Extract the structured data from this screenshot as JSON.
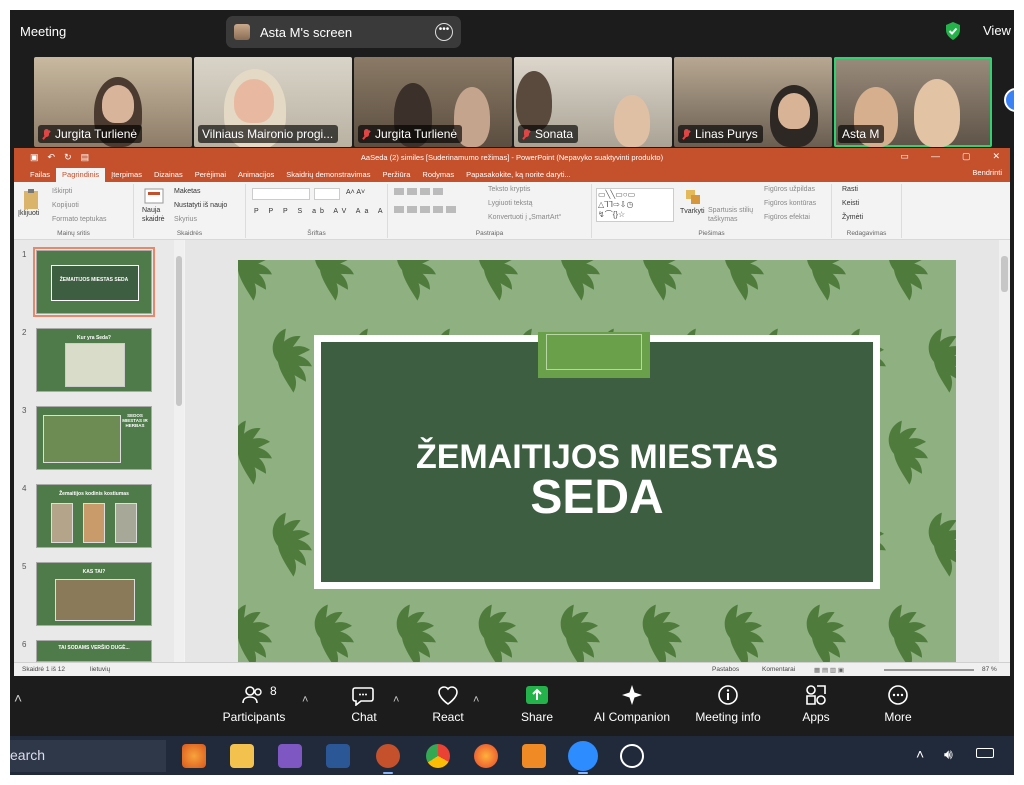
{
  "zoom": {
    "meeting_label": "Meeting",
    "share_label": "Asta M's screen",
    "view_label": "View",
    "participants": [
      {
        "name": "Jurgita Turlienė",
        "muted": true
      },
      {
        "name": "Vilniaus Maironio progi...",
        "muted": false
      },
      {
        "name": "Jurgita Turlienė",
        "muted": true
      },
      {
        "name": "Sonata",
        "muted": true
      },
      {
        "name": "Linas Purys",
        "muted": true
      },
      {
        "name": "Asta M",
        "muted": false
      }
    ],
    "controls": {
      "participants": "Participants",
      "participants_count": "8",
      "chat": "Chat",
      "react": "React",
      "share": "Share",
      "ai": "AI Companion",
      "info": "Meeting info",
      "apps": "Apps",
      "more": "More"
    }
  },
  "ppt": {
    "title": "AaSeda (2) similes [Suderinamumo režimas] - PowerPoint (Nepavyko suaktyvinti produkto)",
    "tabs": [
      "Failas",
      "Pagrindinis",
      "Įterpimas",
      "Dizainas",
      "Perėjimai",
      "Animacijos",
      "Skaidrių demonstravimas",
      "Peržiūra",
      "Rodymas",
      "Papasakokite, ką norite daryti..."
    ],
    "share": "Bendrinti",
    "ribbon": {
      "paste": "Įklijuoti",
      "cut": "Iškirpti",
      "copy": "Kopijuoti",
      "format_painter": "Formato teptukas",
      "clipboard_group": "Mainų sritis",
      "new_slide": "Nauja skaidrė",
      "layout": "Maketas",
      "reset": "Nustatyti iš naujo",
      "section": "Skyrius",
      "slides_group": "Skaidrės",
      "font_group": "Šriftas",
      "text_direction": "Teksto kryptis",
      "align_text": "Lygiuoti tekstą",
      "smartart": "Konvertuoti į „SmartArt“",
      "paragraph_group": "Pastraipa",
      "arrange": "Tvarkyti",
      "quick_styles": "Spartusis stilių taškymas",
      "shape_fill": "Figūros užpildas",
      "shape_outline": "Figūros kontūras",
      "shape_effects": "Figūros efektai",
      "drawing_group": "Piešimas",
      "find": "Rasti",
      "replace": "Keisti",
      "select": "Žymėti",
      "editing_group": "Redagavimas"
    },
    "thumbs": [
      {
        "num": "1",
        "title": "ŽEMAITIJOS MIESTAS SEDA"
      },
      {
        "num": "2",
        "title": "Kur yra Seda?"
      },
      {
        "num": "3",
        "title": "SEDOS MIESTAS IR HERBAS"
      },
      {
        "num": "4",
        "title": "Žemaitijos kodinis kostiumas"
      },
      {
        "num": "5",
        "title": "KAS TAI?"
      },
      {
        "num": "6",
        "title": "TAI SODAMS VERŠIO DUGÈ..."
      }
    ],
    "slide": {
      "line1": "ŽEMAITIJOS MIESTAS",
      "line2": "SEDA"
    },
    "status": {
      "slide_of": "Skaidrė 1 iš 12",
      "lang": "lietuvių",
      "notes": "Pastabos",
      "comments": "Komentarai",
      "zoom": "87 %"
    }
  },
  "taskbar": {
    "search": "earch"
  }
}
